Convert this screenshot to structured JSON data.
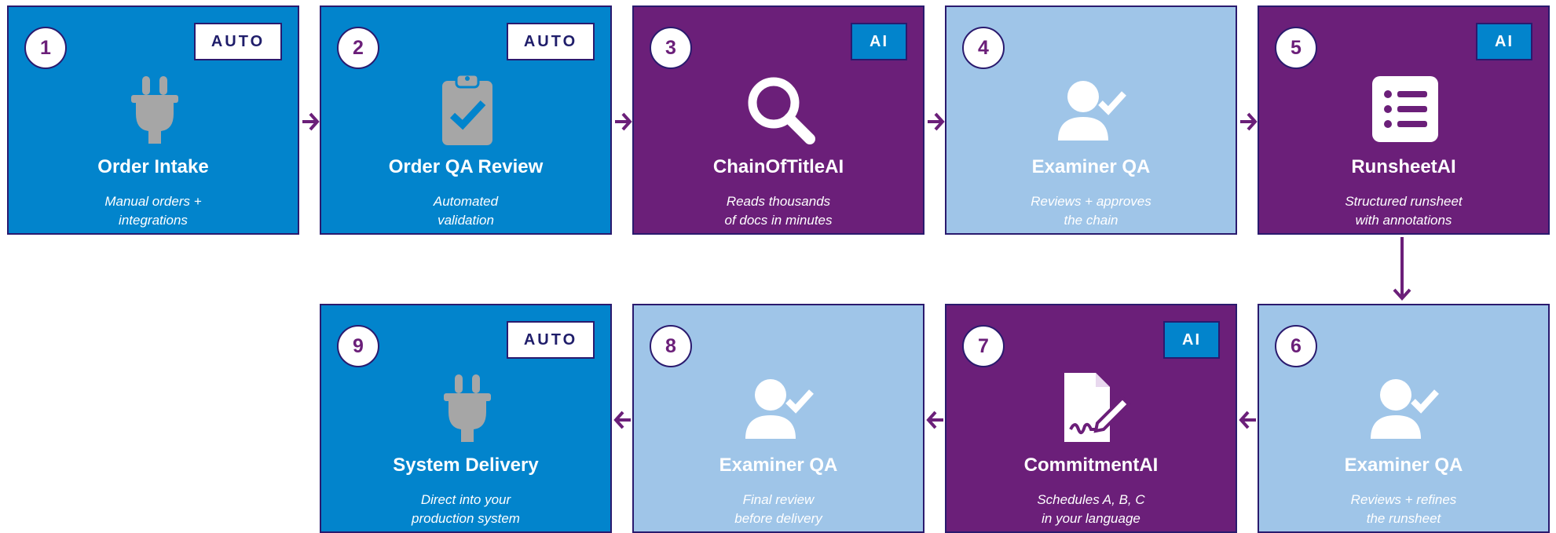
{
  "steps": [
    {
      "number": "1",
      "badge": "AUTO",
      "title": "Order Intake",
      "subtitle": [
        "Manual orders +",
        "integrations"
      ],
      "icon": "plug-icon"
    },
    {
      "number": "2",
      "badge": "AUTO",
      "title": "Order QA Review",
      "subtitle": [
        "Automated",
        "validation"
      ],
      "icon": "clipboard-check-icon"
    },
    {
      "number": "3",
      "badge": "AI",
      "title": "ChainOfTitleAI",
      "subtitle": [
        "Reads thousands",
        "of docs in minutes"
      ],
      "icon": "magnifier-icon"
    },
    {
      "number": "4",
      "badge": "",
      "title": "Examiner QA",
      "subtitle": [
        "Reviews + approves",
        "the chain"
      ],
      "icon": "user-check-icon"
    },
    {
      "number": "5",
      "badge": "AI",
      "title": "RunsheetAI",
      "subtitle": [
        "Structured runsheet",
        "with annotations"
      ],
      "icon": "list-icon"
    },
    {
      "number": "6",
      "badge": "",
      "title": "Examiner QA",
      "subtitle": [
        "Reviews + refines",
        "the runsheet"
      ],
      "icon": "user-check-icon"
    },
    {
      "number": "7",
      "badge": "AI",
      "title": "CommitmentAI",
      "subtitle": [
        "Schedules A, B, C",
        "in your language"
      ],
      "icon": "document-signature-icon"
    },
    {
      "number": "8",
      "badge": "",
      "title": "Examiner QA",
      "subtitle": [
        "Final review",
        "before delivery"
      ],
      "icon": "user-check-icon"
    },
    {
      "number": "9",
      "badge": "AUTO",
      "title": "System Delivery",
      "subtitle": [
        "Direct into your",
        "production system"
      ],
      "icon": "plug-icon"
    }
  ],
  "colors": {
    "auto_card": "#0284cc",
    "ai_card": "#6b1f79",
    "examiner_card": "#9fc5e8",
    "arrow": "#6b1f79",
    "border": "#2a1a6e",
    "icon_gray": "#a6a6a6"
  }
}
